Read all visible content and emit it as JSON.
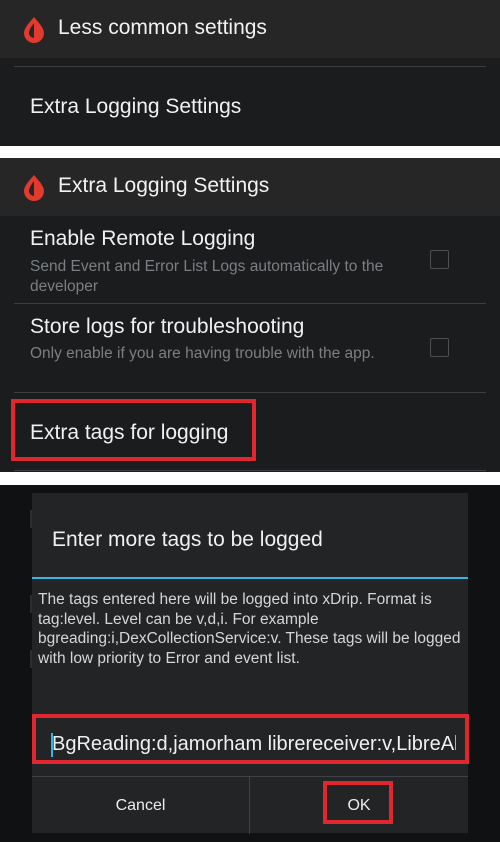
{
  "panel1": {
    "appbar_title": "Less common settings",
    "item_title": "Extra Logging Settings"
  },
  "panel2": {
    "appbar_title": "Extra Logging Settings",
    "items": [
      {
        "title": "Enable Remote Logging",
        "summary": "Send Event and Error List Logs automatically to the developer",
        "checked": false
      },
      {
        "title": "Store logs for troubleshooting",
        "summary": "Only enable if you are having trouble with the app.",
        "checked": false
      },
      {
        "title": "Extra tags for logging"
      }
    ]
  },
  "dialog": {
    "title": "Enter more tags to be logged",
    "message": "The tags entered here will be logged into xDrip. Format is tag:level. Level can be v,d,i. For example bgreading:i,DexCollectionService:v. These tags will be logged with low priority to Error and event list.",
    "input_value": "BgReading:d,jamorham librereceiver:v,LibreAlarmReceiver:d",
    "cancel_label": "Cancel",
    "ok_label": "OK"
  },
  "colors": {
    "accent": "#33b5e5",
    "highlight": "#e0262e",
    "logo": "#e23a2e"
  },
  "icons": {
    "app_logo": "blood-drop-icon"
  }
}
